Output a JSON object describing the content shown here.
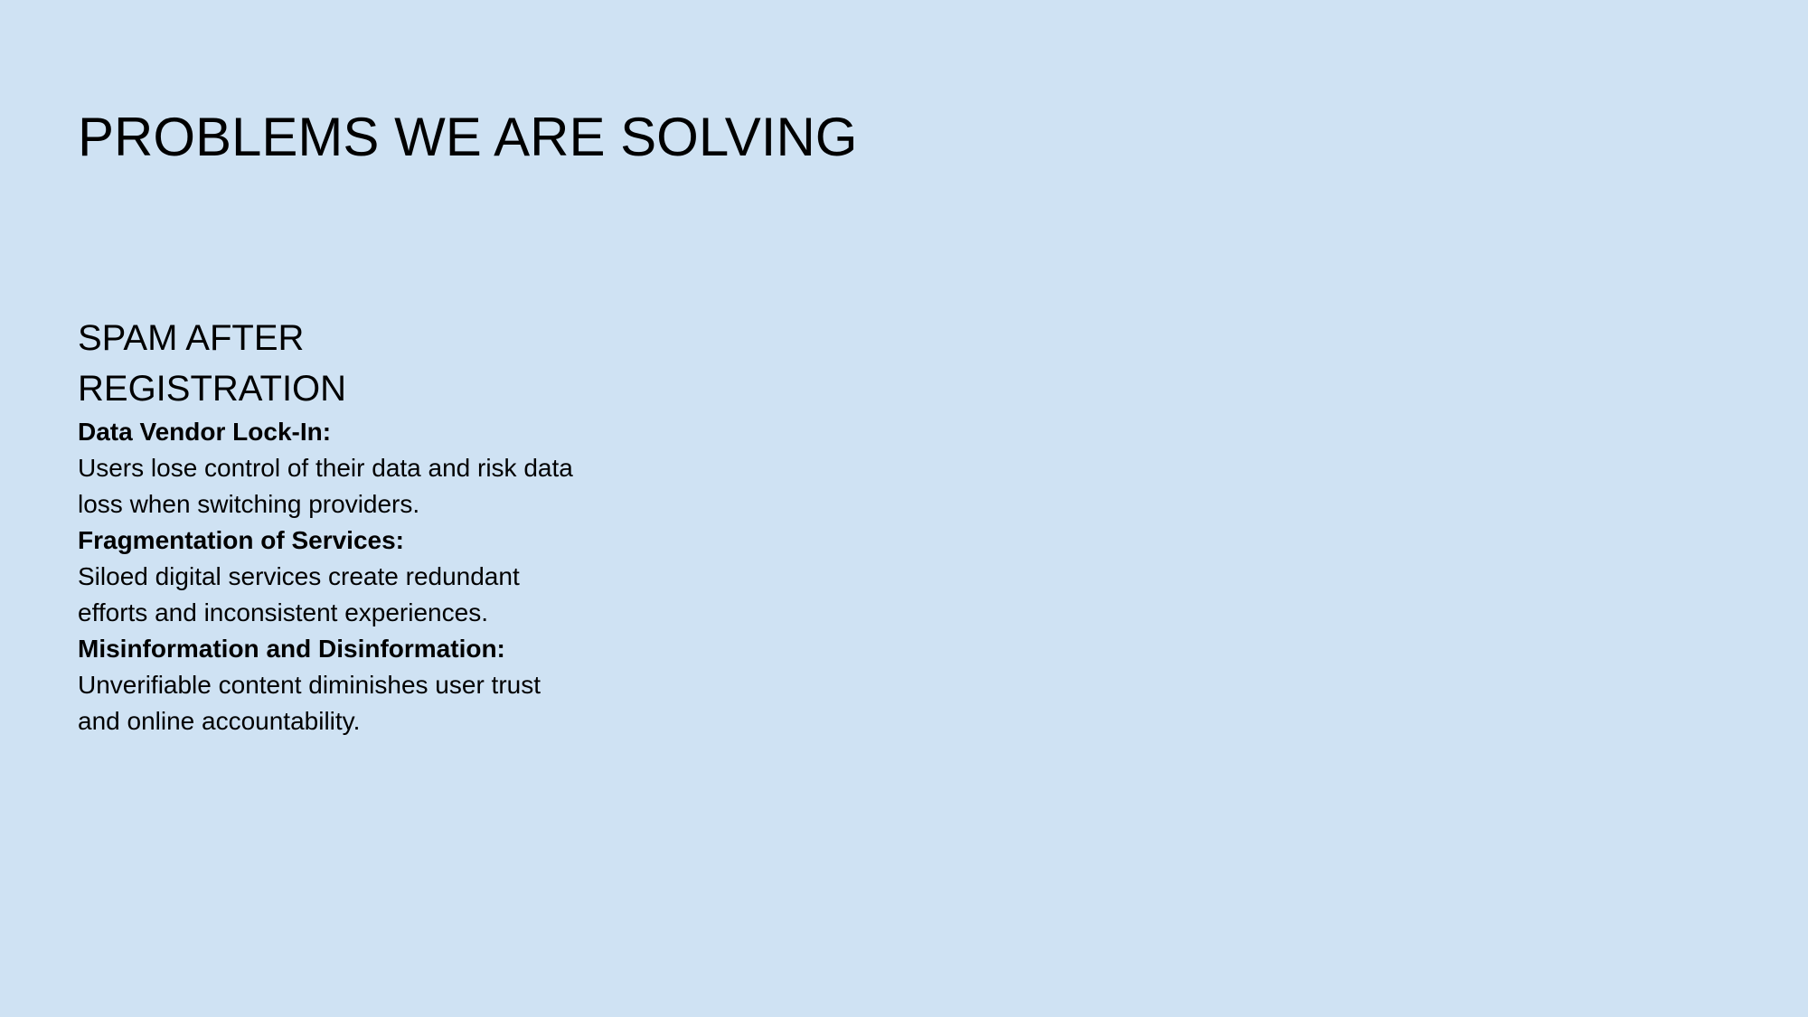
{
  "slide": {
    "title": "PROBLEMS WE ARE SOLVING",
    "section_heading": "SPAM AFTER REGISTRATION",
    "problems": [
      {
        "title": "Data Vendor Lock-In:",
        "description": "Users lose control of their data and risk data loss when switching providers."
      },
      {
        "title": "Fragmentation of Services:",
        "description": "Siloed digital services create redundant efforts and inconsistent experiences."
      },
      {
        "title": "Misinformation and Disinformation:",
        "description": "Unverifiable content diminishes user trust and online accountability."
      }
    ],
    "colors": {
      "background": "#cfe2f3",
      "text": "#000000"
    }
  }
}
